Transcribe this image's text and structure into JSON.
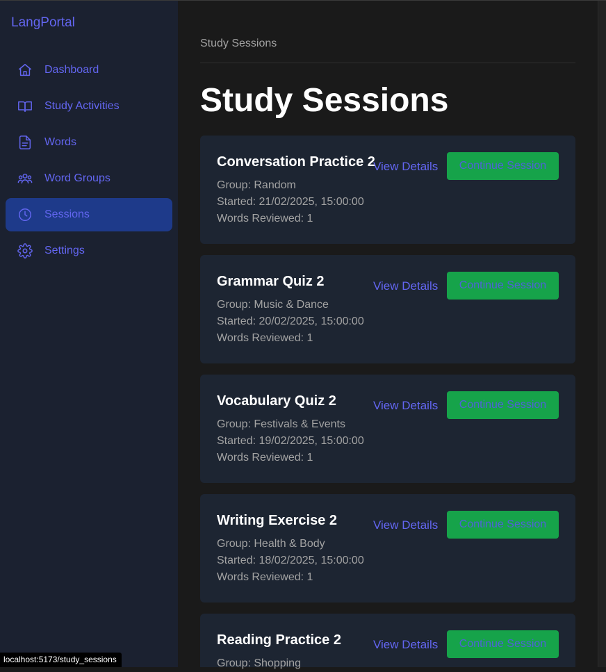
{
  "app": {
    "brand": "LangPortal"
  },
  "sidebar": {
    "items": [
      {
        "label": "Dashboard",
        "icon": "home-icon",
        "active": false
      },
      {
        "label": "Study Activities",
        "icon": "book-open-icon",
        "active": false
      },
      {
        "label": "Words",
        "icon": "file-text-icon",
        "active": false
      },
      {
        "label": "Word Groups",
        "icon": "users-icon",
        "active": false
      },
      {
        "label": "Sessions",
        "icon": "clock-icon",
        "active": true
      },
      {
        "label": "Settings",
        "icon": "gear-icon",
        "active": false
      }
    ]
  },
  "main": {
    "breadcrumb": "Study Sessions",
    "title": "Study Sessions",
    "sessions": [
      {
        "title": "Conversation Practice 2",
        "group": "Group: Random",
        "started": "Started: 21/02/2025, 15:00:00",
        "reviewed": "Words Reviewed: 1",
        "view_label": "View Details",
        "continue_label": "Continue Session"
      },
      {
        "title": "Grammar Quiz 2",
        "group": "Group: Music & Dance",
        "started": "Started: 20/02/2025, 15:00:00",
        "reviewed": "Words Reviewed: 1",
        "view_label": "View Details",
        "continue_label": "Continue Session"
      },
      {
        "title": "Vocabulary Quiz 2",
        "group": "Group: Festivals & Events",
        "started": "Started: 19/02/2025, 15:00:00",
        "reviewed": "Words Reviewed: 1",
        "view_label": "View Details",
        "continue_label": "Continue Session"
      },
      {
        "title": "Writing Exercise 2",
        "group": "Group: Health & Body",
        "started": "Started: 18/02/2025, 15:00:00",
        "reviewed": "Words Reviewed: 1",
        "view_label": "View Details",
        "continue_label": "Continue Session"
      },
      {
        "title": "Reading Practice 2",
        "group": "Group: Shopping",
        "started": "",
        "reviewed": "",
        "view_label": "View Details",
        "continue_label": "Continue Session"
      }
    ]
  },
  "statusbar": {
    "url": "localhost:5173/study_sessions"
  },
  "colors": {
    "accent": "#6366f1",
    "active_bg": "#1e3a8a",
    "sidebar_bg": "#1b2130",
    "card_bg": "#1d2532",
    "button_green": "#16a34a"
  }
}
